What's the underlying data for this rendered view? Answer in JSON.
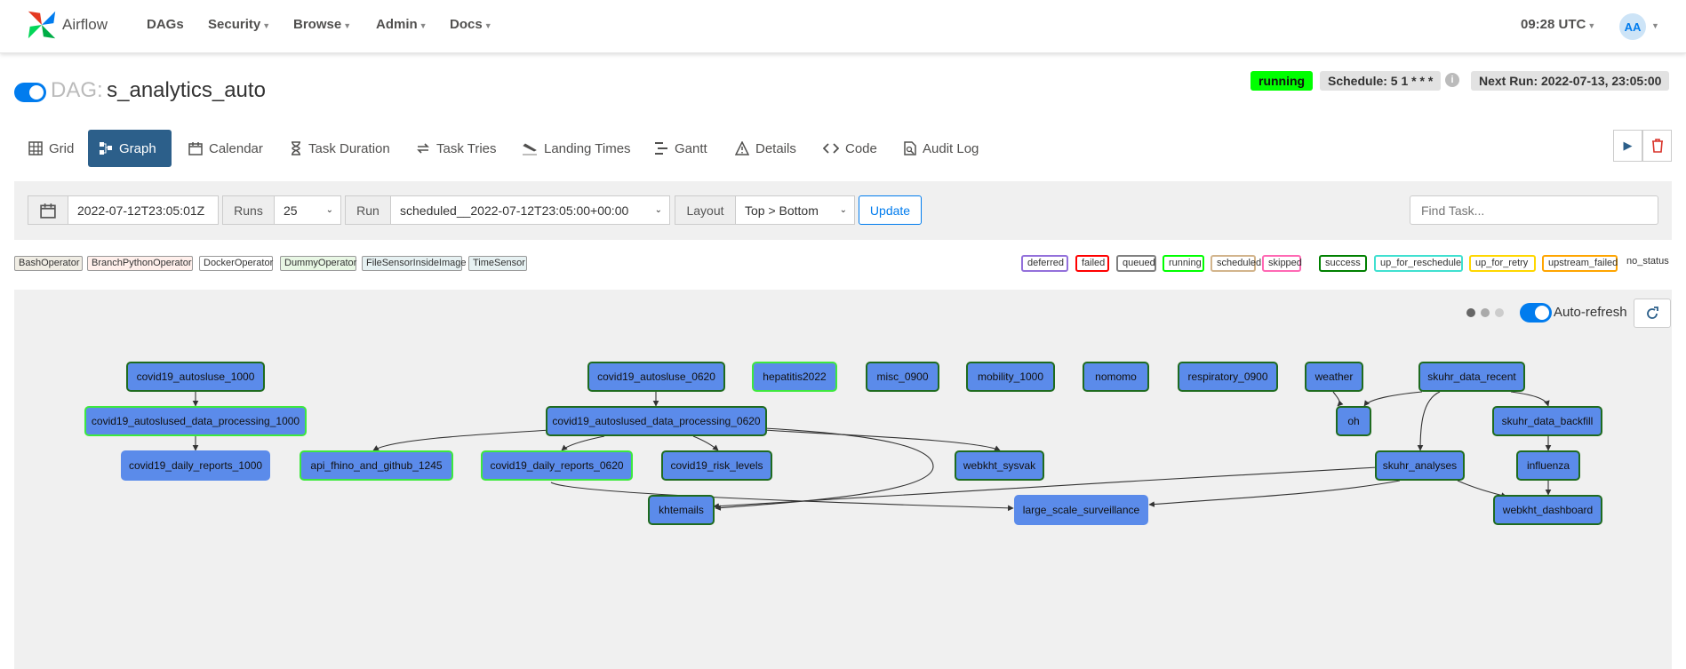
{
  "nav": {
    "brand": "Airflow",
    "items": [
      {
        "label": "DAGs",
        "dropdown": false
      },
      {
        "label": "Security",
        "dropdown": true
      },
      {
        "label": "Browse",
        "dropdown": true
      },
      {
        "label": "Admin",
        "dropdown": true
      },
      {
        "label": "Docs",
        "dropdown": true
      }
    ],
    "time": "09:28 UTC",
    "user_initials": "AA"
  },
  "dag": {
    "prefix": "DAG:",
    "name": "s_analytics_auto",
    "state": "running",
    "schedule": "Schedule: 5 1 * * *",
    "next_run": "Next Run: 2022-07-13, 23:05:00"
  },
  "tabs": [
    {
      "label": "Grid",
      "icon": "grid-icon"
    },
    {
      "label": "Graph",
      "icon": "graph-icon",
      "active": true
    },
    {
      "label": "Calendar",
      "icon": "calendar-icon"
    },
    {
      "label": "Task Duration",
      "icon": "hourglass-icon"
    },
    {
      "label": "Task Tries",
      "icon": "retry-icon"
    },
    {
      "label": "Landing Times",
      "icon": "landing-icon"
    },
    {
      "label": "Gantt",
      "icon": "gantt-icon"
    },
    {
      "label": "Details",
      "icon": "warning-icon"
    },
    {
      "label": "Code",
      "icon": "code-icon"
    },
    {
      "label": "Audit Log",
      "icon": "audit-icon"
    }
  ],
  "controls": {
    "base_date": "2022-07-12T23:05:01Z",
    "runs_label": "Runs",
    "runs_value": "25",
    "run_label": "Run",
    "run_value": "scheduled__2022-07-12T23:05:00+00:00",
    "layout_label": "Layout",
    "layout_value": "Top > Bottom",
    "update_label": "Update",
    "find_placeholder": "Find Task..."
  },
  "operators": [
    {
      "label": "BashOperator",
      "color": "#f0ede4"
    },
    {
      "label": "BranchPythonOperator",
      "color": "#ffefeb"
    },
    {
      "label": "DockerOperator",
      "color": "#ffffff"
    },
    {
      "label": "DummyOperator",
      "color": "#e8f7e4"
    },
    {
      "label": "FileSensorInsideImage",
      "color": "#e6f1f2"
    },
    {
      "label": "TimeSensor",
      "color": "#e6f1f2"
    }
  ],
  "states": [
    {
      "label": "deferred",
      "color": "#9370db"
    },
    {
      "label": "failed",
      "color": "#ff0000"
    },
    {
      "label": "queued",
      "color": "#808080"
    },
    {
      "label": "running",
      "color": "#00ff00"
    },
    {
      "label": "scheduled",
      "color": "#d2b48c"
    },
    {
      "label": "skipped",
      "color": "#ff69b4"
    },
    {
      "label": "success",
      "color": "#008000"
    },
    {
      "label": "up_for_reschedule",
      "color": "#40e0d0"
    },
    {
      "label": "up_for_retry",
      "color": "#ffd700"
    },
    {
      "label": "upstream_failed",
      "color": "#ffa500"
    },
    {
      "label": "no_status",
      "color": "#ffffff"
    }
  ],
  "graph": {
    "auto_refresh": "Auto-refresh",
    "nodes": [
      {
        "id": "n1",
        "label": "covid19_autosluse_1000"
      },
      {
        "id": "n2",
        "label": "covid19_autoslused_data_processing_1000"
      },
      {
        "id": "n3",
        "label": "covid19_daily_reports_1000"
      },
      {
        "id": "n4",
        "label": "api_fhino_and_github_1245"
      },
      {
        "id": "n5",
        "label": "covid19_autosluse_0620"
      },
      {
        "id": "n6",
        "label": "covid19_autoslused_data_processing_0620"
      },
      {
        "id": "n7",
        "label": "covid19_daily_reports_0620"
      },
      {
        "id": "n8",
        "label": "covid19_risk_levels"
      },
      {
        "id": "n9",
        "label": "khtemails"
      },
      {
        "id": "n10",
        "label": "hepatitis2022"
      },
      {
        "id": "n11",
        "label": "misc_0900"
      },
      {
        "id": "n12",
        "label": "mobility_1000"
      },
      {
        "id": "n13",
        "label": "nomomo"
      },
      {
        "id": "n14",
        "label": "respiratory_0900"
      },
      {
        "id": "n15",
        "label": "webkht_sysvak"
      },
      {
        "id": "n16",
        "label": "large_scale_surveillance"
      },
      {
        "id": "n17",
        "label": "weather"
      },
      {
        "id": "n18",
        "label": "skuhr_data_recent"
      },
      {
        "id": "n19",
        "label": "oh"
      },
      {
        "id": "n20",
        "label": "skuhr_data_backfill"
      },
      {
        "id": "n21",
        "label": "skuhr_analyses"
      },
      {
        "id": "n22",
        "label": "influenza"
      },
      {
        "id": "n23",
        "label": "webkht_dashboard"
      }
    ]
  }
}
